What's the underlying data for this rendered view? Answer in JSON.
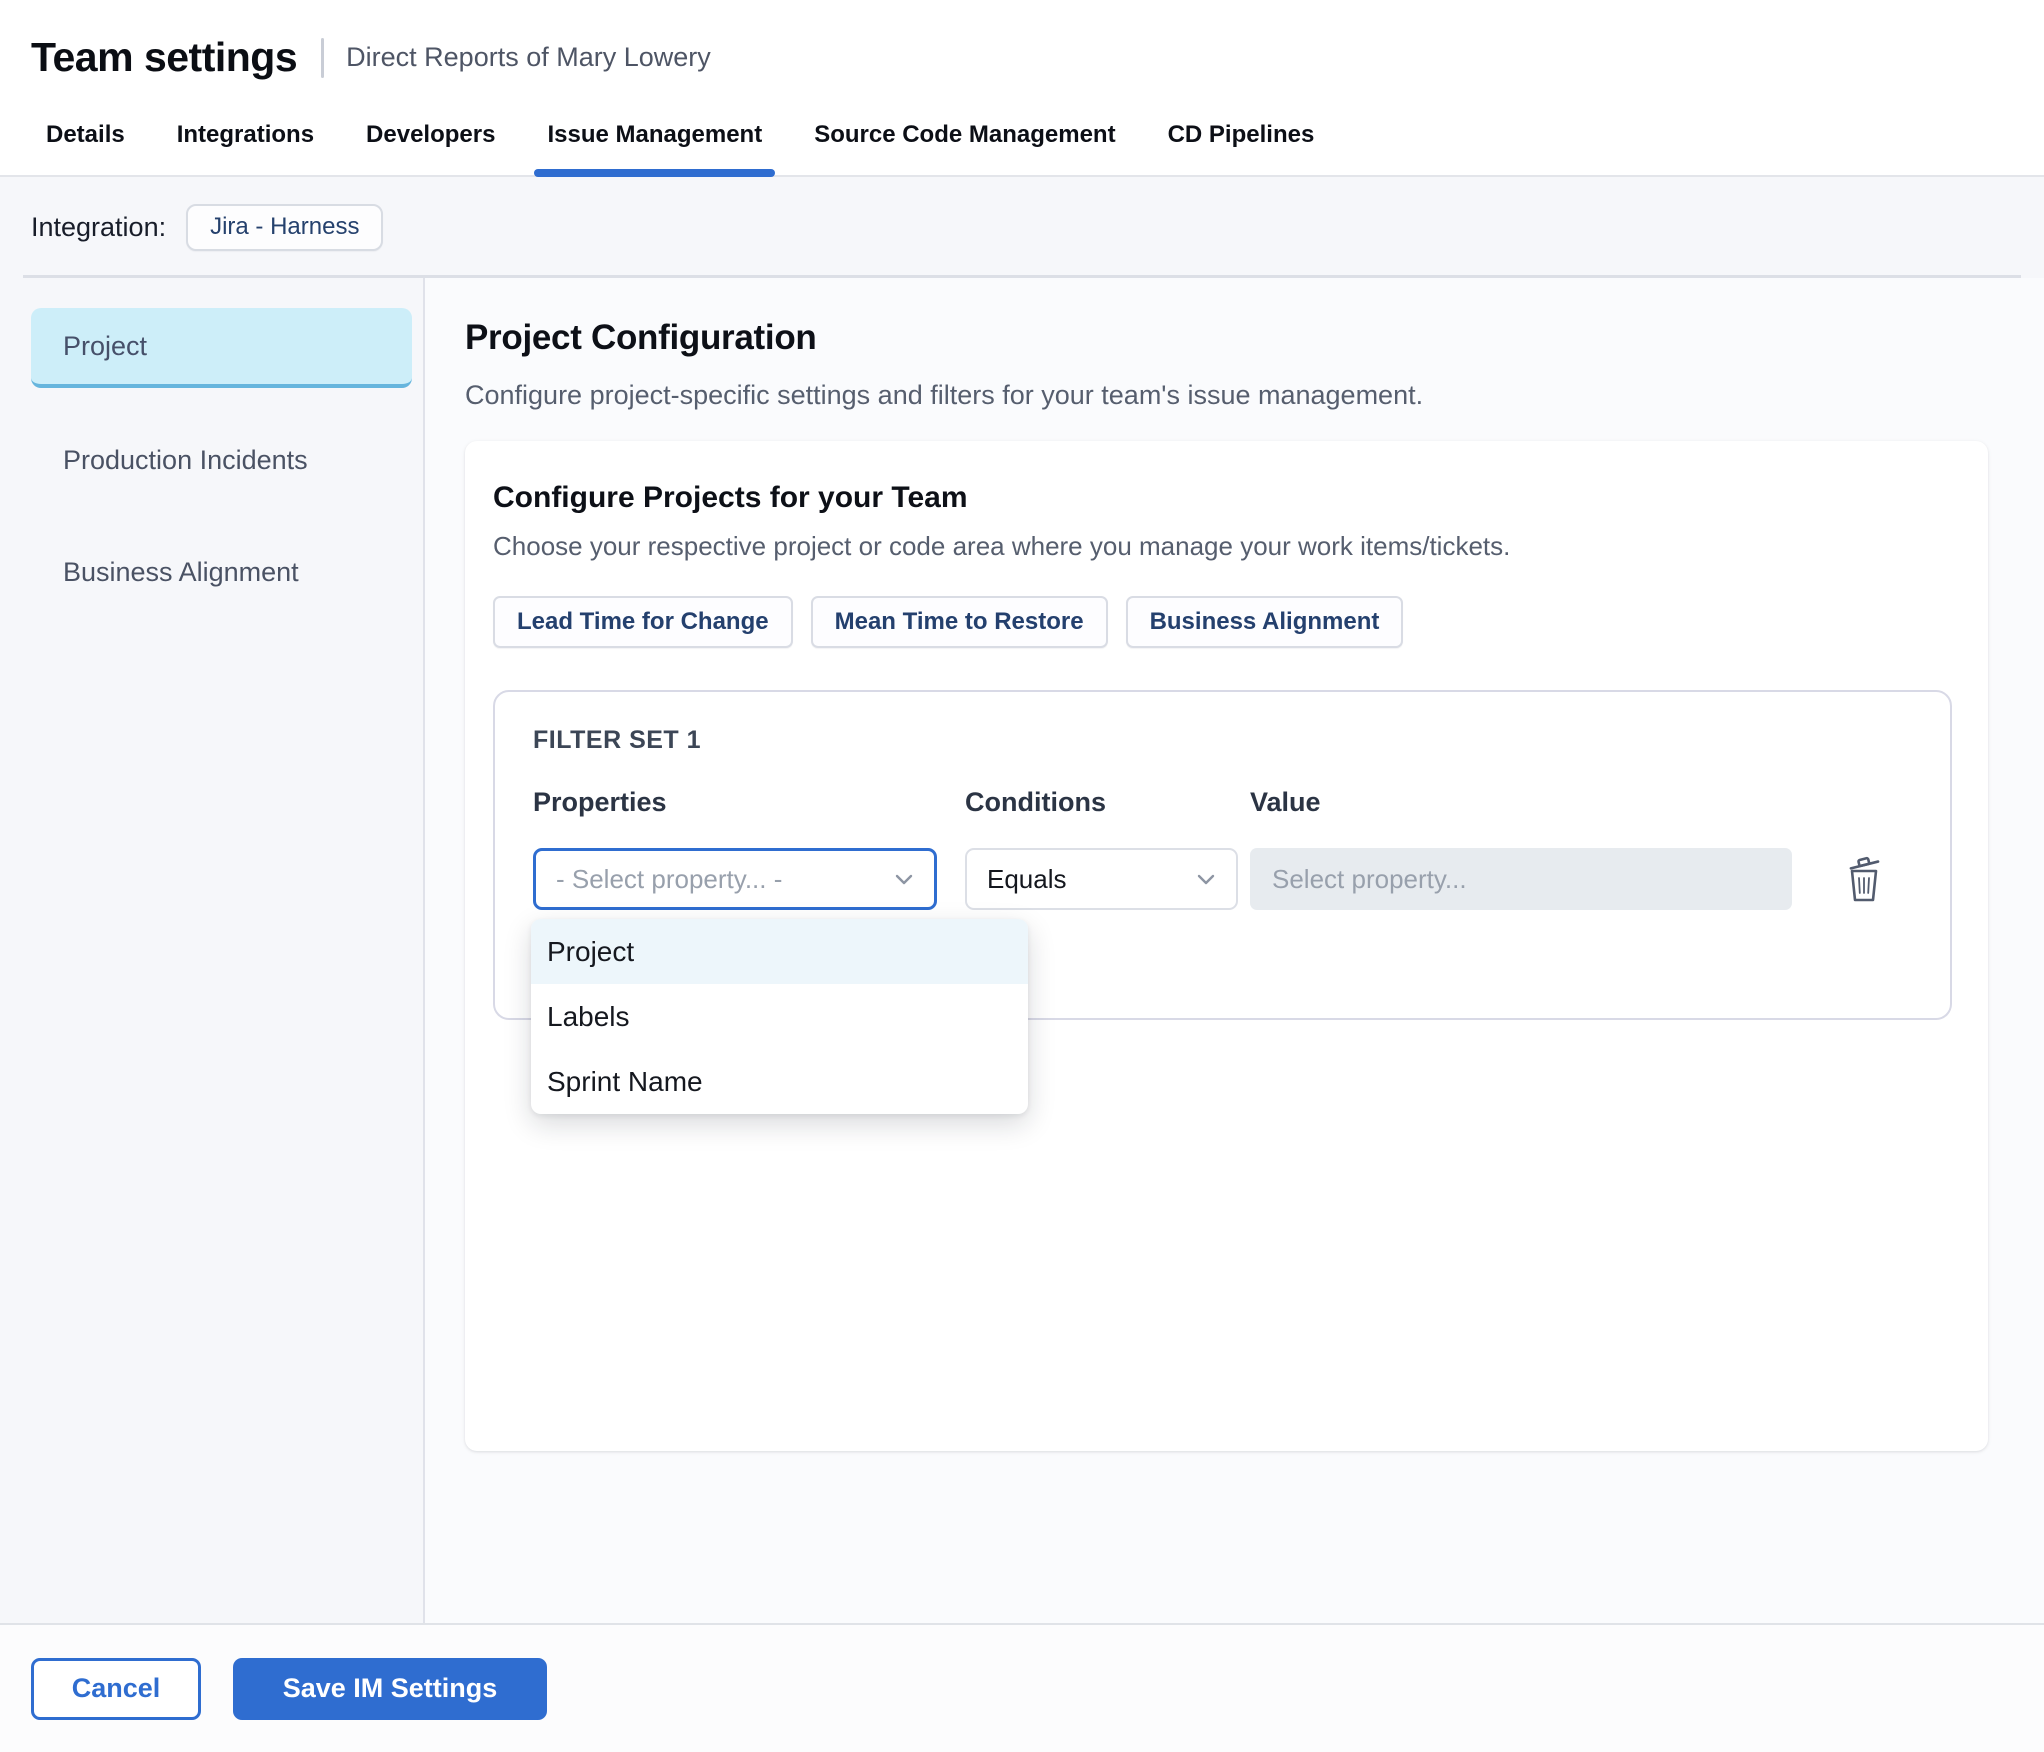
{
  "header": {
    "title": "Team settings",
    "subtitle": "Direct Reports of Mary Lowery"
  },
  "tabs": [
    {
      "label": "Details",
      "active": false
    },
    {
      "label": "Integrations",
      "active": false
    },
    {
      "label": "Developers",
      "active": false
    },
    {
      "label": "Issue Management",
      "active": true
    },
    {
      "label": "Source Code Management",
      "active": false
    },
    {
      "label": "CD Pipelines",
      "active": false
    }
  ],
  "integration": {
    "label": "Integration:",
    "chip": "Jira - Harness"
  },
  "sidebar": {
    "items": [
      {
        "label": "Project",
        "selected": true
      },
      {
        "label": "Production Incidents",
        "selected": false
      },
      {
        "label": "Business Alignment",
        "selected": false
      }
    ]
  },
  "main": {
    "heading": "Project Configuration",
    "description": "Configure project-specific settings and filters for your team's issue management.",
    "card": {
      "title": "Configure Projects for your Team",
      "subtitle": "Choose your respective project or code area where you manage your work items/tickets.",
      "chips": [
        "Lead Time for Change",
        "Mean Time to Restore",
        "Business Alignment"
      ],
      "filter_set": {
        "title": "FILTER SET 1",
        "columns": [
          "Properties",
          "Conditions",
          "Value"
        ],
        "property_placeholder": "- Select property... -",
        "condition_value": "Equals",
        "value_placeholder": "Select property...",
        "dropdown_options": [
          {
            "label": "Project",
            "highlighted": true
          },
          {
            "label": "Labels",
            "highlighted": false
          },
          {
            "label": "Sprint Name",
            "highlighted": false
          }
        ]
      }
    }
  },
  "footer": {
    "cancel_label": "Cancel",
    "save_label": "Save IM Settings"
  },
  "colors": {
    "accent_blue": "#2f6dd0",
    "selected_sidebar_bg": "#cdeef9",
    "selected_sidebar_border": "#66b5dd",
    "dropdown_highlight_bg": "#edf6fb",
    "disabled_input_bg": "#e7ebef",
    "page_bg": "#f6f7fa"
  }
}
